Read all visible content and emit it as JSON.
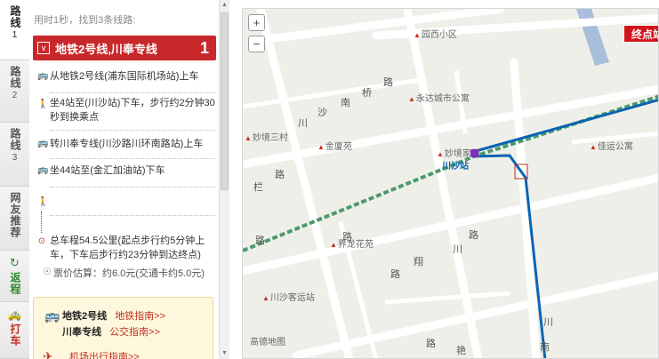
{
  "summary": "用时1秒，找到3条线路:",
  "tabs": [
    {
      "label": "路线",
      "num": "1"
    },
    {
      "label": "路线",
      "num": "2"
    },
    {
      "label": "路线",
      "num": "3"
    },
    {
      "label": "网友推荐"
    },
    {
      "label": "返程"
    },
    {
      "label": "打车"
    }
  ],
  "route": {
    "title": "地铁2号线,川奉专线",
    "index": "1",
    "steps": [
      "从地铁2号线(浦东国际机场站)上车",
      "坐4站至(川沙站)下车，步行约2分钟30秒到换乘点",
      "转川奉专线(川沙路川环南路站)上车",
      "坐44站至(金汇加油站)下车"
    ],
    "total": "总车程54.5公里(起点步行约5分钟上车，下车后步行约23分钟到达终点)",
    "fare": "票价估算：约6.0元(交通卡约5.0元)"
  },
  "recommend": {
    "line1": "地铁2号线",
    "link1": "地铁指南>>",
    "line2": "川奉专线",
    "link2": "公交指南>>",
    "airport": "机场出行指南>>"
  },
  "map": {
    "end_label": "终点站",
    "logo": "高德地图",
    "station": "川沙站",
    "pois": [
      "园西小区",
      "永达城市公寓",
      "妙境三村",
      "金厦苑",
      "妙境家园",
      "佳运公寓",
      "界龙花苑",
      "川沙客运站"
    ],
    "road_chars": [
      "路",
      "川",
      "沙",
      "南",
      "桥",
      "路",
      "路",
      "栏",
      "路",
      "川",
      "路",
      "翔",
      "路",
      "路",
      "艳",
      "路",
      "川",
      "沙",
      "川",
      "南"
    ],
    "zoom_in": "+",
    "zoom_out": "−"
  },
  "colors": {
    "accent": "#c8282a",
    "route_green": "#4d9a6b",
    "route_blue": "#0a64b4"
  },
  "icons": {
    "zoom_in": "zoom-in-icon",
    "zoom_out": "zoom-out-icon",
    "bus": "bus-icon",
    "walk": "walk-icon",
    "plane": "plane-icon"
  }
}
